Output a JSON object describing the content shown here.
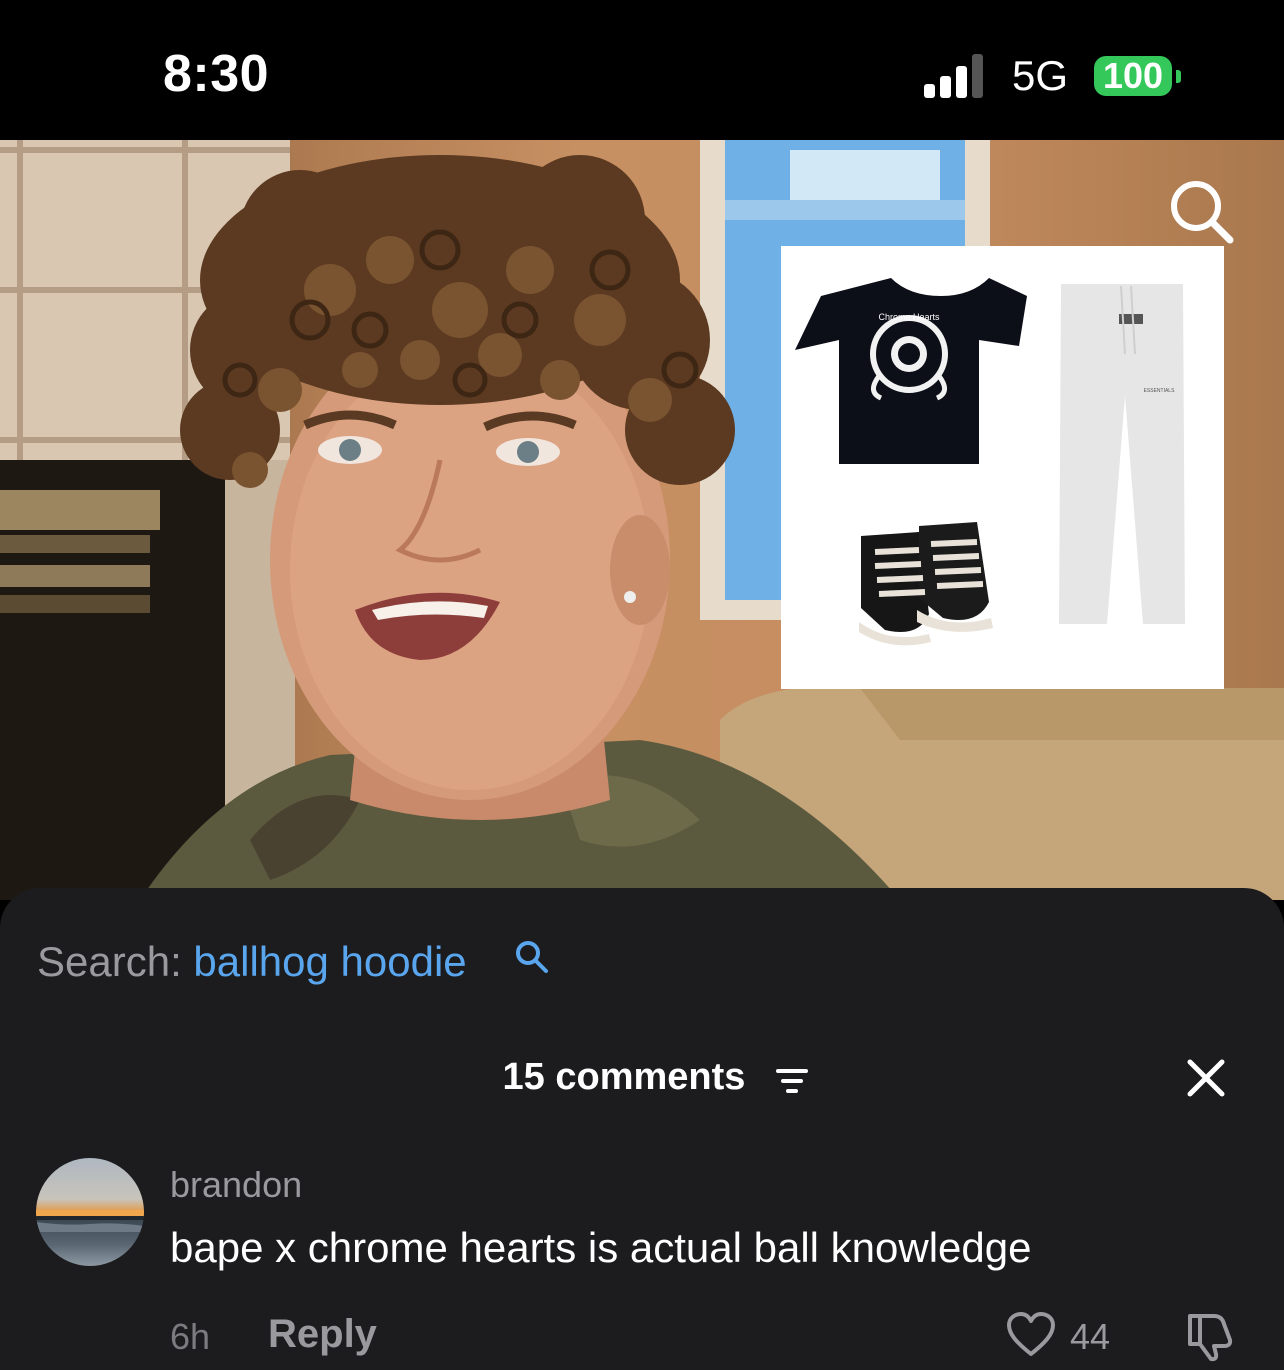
{
  "status_bar": {
    "time": "8:30",
    "network": "5G",
    "battery": "100",
    "battery_color": "#34c759"
  },
  "video": {
    "search_icon": "search-icon",
    "outfit_items": [
      "t-shirt",
      "sweatpants",
      "high-top-sneakers"
    ],
    "tshirt_graphic_text": "Chrome Hearts",
    "pants_label": "ESSENTIALS"
  },
  "search_banner": {
    "prefix": "Search:",
    "term": "ballhog hoodie",
    "term_color": "#5aa6ee"
  },
  "comments": {
    "title": "15 comments",
    "filter_icon": "filter-icon",
    "close_icon": "close-icon",
    "items": [
      {
        "username": "brandon",
        "text": "bape x chrome hearts is actual ball knowledge",
        "time": "6h",
        "reply_label": "Reply",
        "likes": "44"
      }
    ]
  }
}
